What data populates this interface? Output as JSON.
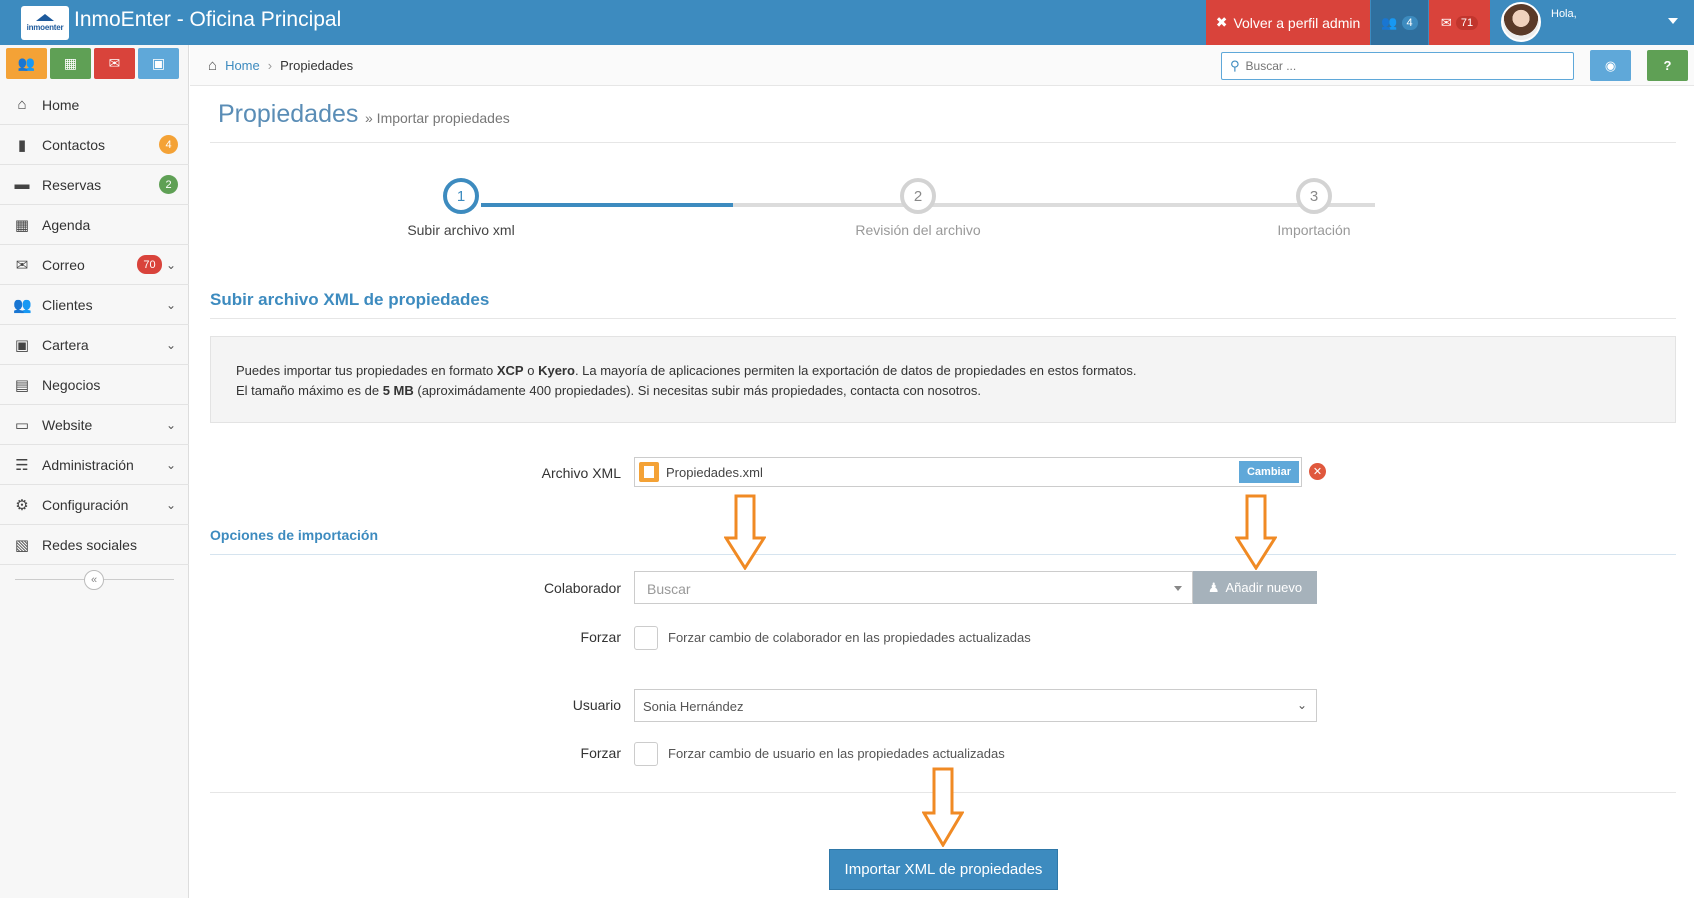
{
  "topbar": {
    "logo_text": "inmoenter",
    "title": "InmoEnter - Oficina Principal",
    "admin_label": "Volver a perfil admin",
    "users_count": "4",
    "mail_count": "71",
    "greeting": "Hola,"
  },
  "sidebar": {
    "items": [
      {
        "label": "Home"
      },
      {
        "label": "Contactos",
        "badge": "4"
      },
      {
        "label": "Reservas",
        "badge": "2"
      },
      {
        "label": "Agenda"
      },
      {
        "label": "Correo",
        "badge": "70"
      },
      {
        "label": "Clientes"
      },
      {
        "label": "Cartera"
      },
      {
        "label": "Negocios"
      },
      {
        "label": "Website"
      },
      {
        "label": "Administración"
      },
      {
        "label": "Configuración"
      },
      {
        "label": "Redes sociales"
      }
    ]
  },
  "breadcrumb": {
    "home": "Home",
    "current": "Propiedades"
  },
  "search": {
    "placeholder": "Buscar ..."
  },
  "page": {
    "title": "Propiedades",
    "subtitle": "» Importar propiedades"
  },
  "stepper": {
    "steps": [
      {
        "num": "1",
        "label": "Subir archivo xml"
      },
      {
        "num": "2",
        "label": "Revisión del archivo"
      },
      {
        "num": "3",
        "label": "Importación"
      }
    ]
  },
  "upload": {
    "heading": "Subir archivo XML de propiedades",
    "info_line1_a": "Puedes importar tus propiedades en formato ",
    "info_xcp": "XCP",
    "info_line1_b": " o ",
    "info_kyero": "Kyero",
    "info_line1_c": ". La mayoría de aplicaciones permiten la exportación de datos de propiedades en estos formatos.",
    "info_line2_a": "El tamaño máximo es de ",
    "info_size": "5 MB",
    "info_line2_b": " (aproximádamente 400 propiedades). Si necesitas subir más propiedades, contacta con nosotros.",
    "file_label": "Archivo XML",
    "file_name": "Propiedades.xml",
    "change_label": "Cambiar"
  },
  "options": {
    "heading": "Opciones de importación",
    "collab_label": "Colaborador",
    "collab_placeholder": "Buscar",
    "add_new_label": "Añadir nuevo",
    "force_label": "Forzar",
    "force_collab_text": "Forzar cambio de colaborador en las propiedades actualizadas",
    "user_label": "Usuario",
    "user_value": "Sonia Hernández",
    "force_user_text": "Forzar cambio de usuario en las propiedades actualizadas"
  },
  "submit_label": "Importar XML de propiedades",
  "colors": {
    "primary": "#3d8bbf",
    "danger": "#d9433b",
    "warning": "#f4a236",
    "success": "#5fa055",
    "arrow": "#f08a24"
  }
}
